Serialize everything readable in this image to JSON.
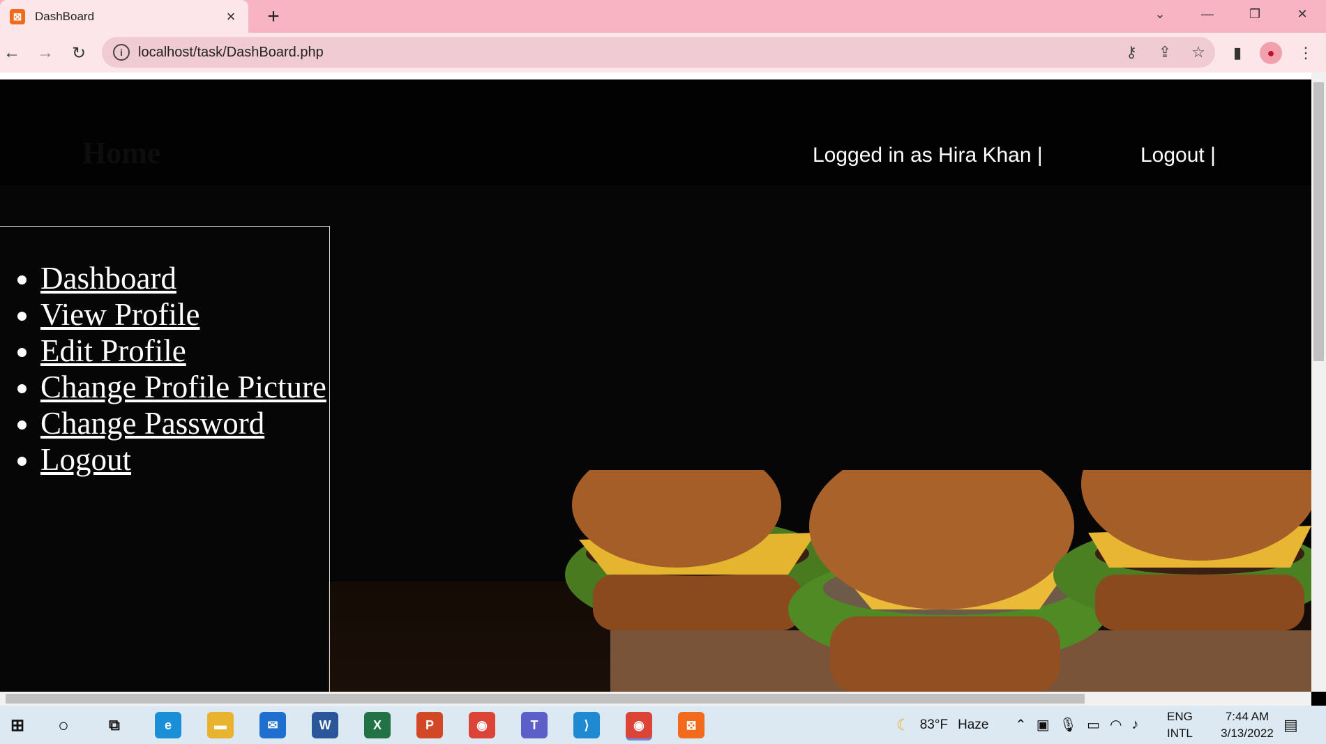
{
  "browser": {
    "tab_title": "DashBoard",
    "tab_close": "×",
    "new_tab": "+",
    "url": "localhost/task/DashBoard.php"
  },
  "page": {
    "brand": "Home",
    "logged_in_text": "Logged in as Hira Khan |",
    "logout_top": "Logout |",
    "menu": [
      {
        "label": "Dashboard"
      },
      {
        "label": "View Profile"
      },
      {
        "label": "Edit Profile"
      },
      {
        "label": "Change Profile Picture"
      },
      {
        "label": "Change Password"
      },
      {
        "label": "Logout"
      }
    ]
  },
  "taskbar": {
    "weather": "83°F",
    "weather_desc": "Haze",
    "lang_top": "ENG",
    "lang_bottom": "INTL",
    "time": "7:44 AM",
    "date": "3/13/2022"
  },
  "colors": {
    "chrome_frame": "#f8b4c2",
    "chrome_toolbar": "#fde6ea",
    "page_bg": "#060606"
  }
}
